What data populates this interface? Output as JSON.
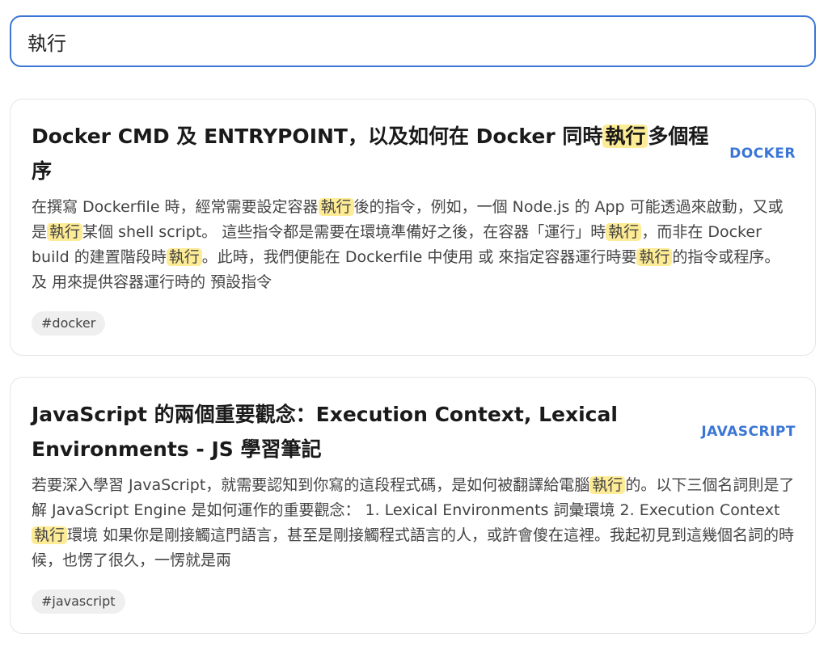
{
  "search": {
    "value": "執行",
    "placeholder": ""
  },
  "highlight_color": "#fdeb95",
  "accent_color": "#3b76d6",
  "results": [
    {
      "title_segments": [
        {
          "text": "Docker CMD 及 ENTRYPOINT，以及如何在 Docker 同時",
          "hl": false
        },
        {
          "text": "執行",
          "hl": true
        },
        {
          "text": "多個程序",
          "hl": false
        }
      ],
      "category": "DOCKER",
      "excerpt_segments": [
        {
          "text": "在撰寫 Dockerfile 時，經常需要設定容器",
          "hl": false
        },
        {
          "text": "執行",
          "hl": true
        },
        {
          "text": "後的指令，例如，一個 Node.js 的 App 可能透過來啟動，又或是",
          "hl": false
        },
        {
          "text": "執行",
          "hl": true
        },
        {
          "text": "某個 shell script。 這些指令都是需要在環境準備好之後，在容器「運行」時",
          "hl": false
        },
        {
          "text": "執行",
          "hl": true
        },
        {
          "text": "，而非在 Docker build 的建置階段時",
          "hl": false
        },
        {
          "text": "執行",
          "hl": true
        },
        {
          "text": "。此時，我們便能在 Dockerfile 中使用 或 來指定容器運行時要",
          "hl": false
        },
        {
          "text": "執行",
          "hl": true
        },
        {
          "text": "的指令或程序。 及 用來提供容器運行時的 預設指令",
          "hl": false
        }
      ],
      "tags": [
        "#docker"
      ]
    },
    {
      "title_segments": [
        {
          "text": "JavaScript 的兩個重要觀念：Execution Context, Lexical Environments - JS 學習筆記",
          "hl": false
        }
      ],
      "category": "JAVASCRIPT",
      "excerpt_segments": [
        {
          "text": "若要深入學習 JavaScript，就需要認知到你寫的這段程式碼，是如何被翻譯給電腦",
          "hl": false
        },
        {
          "text": "執行",
          "hl": true
        },
        {
          "text": "的。以下三個名詞則是了解 JavaScript Engine 是如何運作的重要觀念： 1. Lexical Environments 詞彙環境 2. Execution Context ",
          "hl": false
        },
        {
          "text": "執行",
          "hl": true
        },
        {
          "text": "環境 如果你是剛接觸這門語言，甚至是剛接觸程式語言的人，或許會傻在這裡。我起初見到這幾個名詞的時候，也愣了很久，一愣就是兩",
          "hl": false
        }
      ],
      "tags": [
        "#javascript"
      ]
    }
  ]
}
